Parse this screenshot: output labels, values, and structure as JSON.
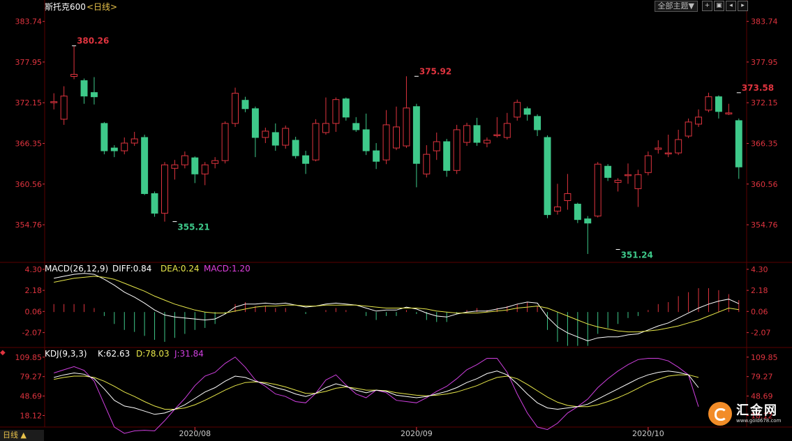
{
  "header": {
    "symbol": "斯托克600",
    "period": "<日线>",
    "theme_button": "全部主题▼",
    "tool_icons": [
      "crosshair-icon",
      "expand-icon",
      "prev-icon",
      "next-icon"
    ]
  },
  "bottom_bar": {
    "label": "日线 ▲"
  },
  "logo": {
    "name": "汇金网",
    "url": "www.gold678.com"
  },
  "colors": {
    "up": "#e0343f",
    "down": "#3ec98a",
    "diff_line": "#ffffff",
    "dea_line": "#e8e84a",
    "macd_label": "#e040e0",
    "k_line": "#ffffff",
    "d_line": "#e8e84a",
    "j_line": "#d040e0",
    "axis_text": "#e0343f",
    "grid": "#5a0000"
  },
  "chart_data": [
    {
      "type": "candlestick",
      "title": "斯托克600",
      "ylim": [
        349.5,
        385.0
      ],
      "y_ticks": [
        "383.74",
        "377.95",
        "372.15",
        "366.35",
        "360.56",
        "354.76"
      ],
      "x_ticks": [
        {
          "label": "2020/08",
          "index": 14
        },
        {
          "label": "2020/09",
          "index": 36
        },
        {
          "label": "2020/10",
          "index": 59
        }
      ],
      "annotations": [
        {
          "text": "380.26",
          "index": 2,
          "value": 380.26,
          "kind": "high"
        },
        {
          "text": "355.21",
          "index": 12,
          "value": 355.21,
          "kind": "low"
        },
        {
          "text": "375.92",
          "index": 36,
          "value": 375.92,
          "kind": "high"
        },
        {
          "text": "351.24",
          "index": 56,
          "value": 351.24,
          "kind": "low"
        },
        {
          "text": "373.58",
          "index": 68,
          "value": 373.58,
          "kind": "high"
        }
      ],
      "candles": [
        [
          372.3,
          372.3,
          371.2,
          373.5
        ],
        [
          369.8,
          373.1,
          369.0,
          374.5
        ],
        [
          375.9,
          376.2,
          375.5,
          380.26
        ],
        [
          375.3,
          373.1,
          372.0,
          375.6
        ],
        [
          373.6,
          373.0,
          371.9,
          375.8
        ],
        [
          369.2,
          365.3,
          364.8,
          369.4
        ],
        [
          365.7,
          365.3,
          364.4,
          366.1
        ],
        [
          365.3,
          366.4,
          364.8,
          367.2
        ],
        [
          366.4,
          367.0,
          366.0,
          368.0
        ],
        [
          367.2,
          359.2,
          359.0,
          367.6
        ],
        [
          359.2,
          356.4,
          355.9,
          359.5
        ],
        [
          356.4,
          363.3,
          355.21,
          363.7
        ],
        [
          362.8,
          363.3,
          361.2,
          364.0
        ],
        [
          363.3,
          364.6,
          362.8,
          365.2
        ],
        [
          364.3,
          362.0,
          360.7,
          364.5
        ],
        [
          362.0,
          363.3,
          360.4,
          363.7
        ],
        [
          363.5,
          363.9,
          362.8,
          364.4
        ],
        [
          363.9,
          369.2,
          363.5,
          369.5
        ],
        [
          369.2,
          373.5,
          368.7,
          374.3
        ],
        [
          372.5,
          371.3,
          370.8,
          373.0
        ],
        [
          371.3,
          367.2,
          364.4,
          371.6
        ],
        [
          367.2,
          368.1,
          366.4,
          368.6
        ],
        [
          367.9,
          366.1,
          365.3,
          369.2
        ],
        [
          366.1,
          368.5,
          365.6,
          368.9
        ],
        [
          366.8,
          364.6,
          364.2,
          367.3
        ],
        [
          364.6,
          363.5,
          362.0,
          365.3
        ],
        [
          364.0,
          369.2,
          363.8,
          369.8
        ],
        [
          367.9,
          369.2,
          367.6,
          372.9
        ],
        [
          369.2,
          372.6,
          368.0,
          372.9
        ],
        [
          372.7,
          370.1,
          369.6,
          372.9
        ],
        [
          369.2,
          368.3,
          368.0,
          370.1
        ],
        [
          368.3,
          365.3,
          364.7,
          370.6
        ],
        [
          365.3,
          363.8,
          362.7,
          366.4
        ],
        [
          364.0,
          369.0,
          363.4,
          371.1
        ],
        [
          365.7,
          368.7,
          365.4,
          371.6
        ],
        [
          366.0,
          371.4,
          365.7,
          375.92
        ],
        [
          371.6,
          363.5,
          360.1,
          372.0
        ],
        [
          362.0,
          364.8,
          361.5,
          366.1
        ],
        [
          365.3,
          366.6,
          364.0,
          367.9
        ],
        [
          366.6,
          362.5,
          361.6,
          367.0
        ],
        [
          362.5,
          368.3,
          362.0,
          369.0
        ],
        [
          366.5,
          368.9,
          366.0,
          369.3
        ],
        [
          368.9,
          366.5,
          366.0,
          370.0
        ],
        [
          366.4,
          366.8,
          365.8,
          367.2
        ],
        [
          367.6,
          367.6,
          367.2,
          370.1
        ],
        [
          367.2,
          369.2,
          366.9,
          370.7
        ],
        [
          370.1,
          372.2,
          369.6,
          372.6
        ],
        [
          371.3,
          370.5,
          369.6,
          371.6
        ],
        [
          370.2,
          368.3,
          367.4,
          370.5
        ],
        [
          367.2,
          356.2,
          355.7,
          367.5
        ],
        [
          356.7,
          357.3,
          356.2,
          360.6
        ],
        [
          358.2,
          359.2,
          356.9,
          362.0
        ],
        [
          357.7,
          355.5,
          355.0,
          357.9
        ],
        [
          355.6,
          355.0,
          350.6,
          356.0
        ],
        [
          356.0,
          363.4,
          355.8,
          363.7
        ],
        [
          363.1,
          361.5,
          361.0,
          363.4
        ],
        [
          360.8,
          361.1,
          359.5,
          361.4
        ],
        [
          361.8,
          361.9,
          360.6,
          363.5
        ],
        [
          359.9,
          361.9,
          357.3,
          362.6
        ],
        [
          362.2,
          364.6,
          361.8,
          365.2
        ],
        [
          365.5,
          365.7,
          364.9,
          366.8
        ],
        [
          365.0,
          365.0,
          364.4,
          367.6
        ],
        [
          365.0,
          366.9,
          364.7,
          368.3
        ],
        [
          367.4,
          369.4,
          367.1,
          369.9
        ],
        [
          369.1,
          370.1,
          368.7,
          371.2
        ],
        [
          371.1,
          373.0,
          370.8,
          373.58
        ],
        [
          373.0,
          370.9,
          369.9,
          373.2
        ],
        [
          370.7,
          370.7,
          370.4,
          372.0
        ],
        [
          369.6,
          363.0,
          361.3,
          369.9
        ]
      ]
    },
    {
      "type": "line",
      "title": "MACD(26,12,9)",
      "labels": [
        {
          "text": "MACD(26,12,9)",
          "color": "#ffffff"
        },
        {
          "text": "DIFF:0.84",
          "color": "#ffffff"
        },
        {
          "text": "DEA:0.24",
          "color": "#e8e84a"
        },
        {
          "text": "MACD:1.20",
          "color": "#e040e0"
        }
      ],
      "ylim": [
        -3.5,
        5.0
      ],
      "y_ticks": [
        "4.30",
        "2.18",
        "0.06",
        "-2.07"
      ],
      "series": [
        {
          "name": "DIFF",
          "values": [
            3.4,
            3.6,
            3.8,
            3.9,
            3.8,
            3.3,
            2.7,
            2.0,
            1.5,
            0.9,
            0.2,
            -0.3,
            -0.5,
            -0.6,
            -0.7,
            -0.8,
            -0.7,
            -0.2,
            0.5,
            0.8,
            0.8,
            0.9,
            0.8,
            0.9,
            0.7,
            0.5,
            0.6,
            0.8,
            0.9,
            0.8,
            0.7,
            0.4,
            0.1,
            0.2,
            0.2,
            0.5,
            0.3,
            -0.1,
            -0.4,
            -0.5,
            -0.2,
            0.0,
            0.1,
            0.1,
            0.3,
            0.5,
            0.8,
            1.0,
            0.9,
            -0.5,
            -1.5,
            -2.1,
            -2.5,
            -2.9,
            -2.6,
            -2.5,
            -2.5,
            -2.3,
            -2.2,
            -1.8,
            -1.4,
            -1.1,
            -0.6,
            -0.1,
            0.4,
            0.8,
            1.1,
            1.3,
            0.84
          ]
        },
        {
          "name": "DEA",
          "values": [
            3.0,
            3.2,
            3.4,
            3.5,
            3.6,
            3.5,
            3.3,
            2.9,
            2.5,
            2.1,
            1.6,
            1.2,
            0.8,
            0.5,
            0.2,
            0.0,
            -0.1,
            -0.1,
            0.1,
            0.3,
            0.5,
            0.6,
            0.6,
            0.7,
            0.7,
            0.6,
            0.6,
            0.7,
            0.7,
            0.7,
            0.7,
            0.6,
            0.5,
            0.4,
            0.4,
            0.4,
            0.4,
            0.3,
            0.1,
            0.0,
            -0.1,
            -0.1,
            -0.1,
            0.0,
            0.1,
            0.2,
            0.4,
            0.5,
            0.6,
            0.4,
            0.0,
            -0.4,
            -0.8,
            -1.2,
            -1.5,
            -1.7,
            -1.9,
            -2.0,
            -2.0,
            -1.9,
            -1.8,
            -1.6,
            -1.4,
            -1.1,
            -0.8,
            -0.4,
            0.0,
            0.4,
            0.24
          ]
        },
        {
          "name": "MACD",
          "values": [
            0.8,
            0.8,
            0.8,
            0.8,
            0.4,
            -0.4,
            -1.2,
            -1.8,
            -2.0,
            -2.4,
            -2.8,
            -3.0,
            -2.6,
            -2.2,
            -1.8,
            -1.6,
            -1.2,
            -0.2,
            0.8,
            1.0,
            0.6,
            0.6,
            0.4,
            0.4,
            0.0,
            -0.2,
            0.0,
            0.2,
            0.4,
            0.2,
            0.0,
            -0.4,
            -0.8,
            -0.4,
            -0.4,
            0.2,
            -0.2,
            -0.8,
            -1.0,
            -1.0,
            -0.2,
            0.2,
            0.4,
            0.2,
            0.4,
            0.6,
            0.8,
            1.0,
            0.6,
            -1.8,
            -3.0,
            -3.4,
            -3.4,
            -3.4,
            -2.2,
            -1.6,
            -1.2,
            -0.6,
            -0.4,
            0.2,
            0.8,
            1.0,
            1.6,
            2.0,
            2.4,
            2.4,
            2.2,
            1.8,
            1.2
          ]
        }
      ]
    },
    {
      "type": "line",
      "title": "KDJ(9,3,3)",
      "labels": [
        {
          "text": "KDJ(9,3,3)",
          "color": "#ffffff"
        },
        {
          "text": "K:62.63",
          "color": "#ffffff"
        },
        {
          "text": "D:78.03",
          "color": "#e8e84a"
        },
        {
          "text": "J:31.84",
          "color": "#d040e0"
        }
      ],
      "ylim": [
        0,
        125
      ],
      "y_ticks": [
        "109.85",
        "79.27",
        "48.69",
        "18.12"
      ],
      "series": [
        {
          "name": "K",
          "values": [
            78,
            82,
            85,
            83,
            76,
            60,
            42,
            33,
            30,
            25,
            20,
            22,
            28,
            35,
            45,
            55,
            62,
            72,
            80,
            78,
            72,
            68,
            62,
            58,
            52,
            48,
            53,
            62,
            68,
            64,
            58,
            54,
            58,
            56,
            50,
            48,
            46,
            48,
            52,
            56,
            62,
            70,
            76,
            84,
            88,
            82,
            68,
            52,
            38,
            30,
            28,
            30,
            32,
            36,
            44,
            52,
            60,
            68,
            76,
            82,
            86,
            88,
            86,
            82,
            62
          ]
        },
        {
          "name": "D",
          "values": [
            75,
            78,
            80,
            80,
            78,
            72,
            64,
            55,
            48,
            40,
            33,
            28,
            28,
            30,
            35,
            42,
            50,
            58,
            65,
            70,
            71,
            70,
            67,
            63,
            58,
            53,
            53,
            56,
            61,
            63,
            61,
            58,
            58,
            57,
            54,
            52,
            50,
            49,
            50,
            52,
            55,
            60,
            65,
            72,
            78,
            80,
            76,
            67,
            57,
            47,
            39,
            34,
            32,
            32,
            35,
            40,
            46,
            53,
            61,
            69,
            75,
            80,
            82,
            82,
            78
          ]
        },
        {
          "name": "J",
          "values": [
            85,
            90,
            95,
            89,
            72,
            36,
            0,
            -10,
            -6,
            -5,
            -6,
            10,
            28,
            45,
            65,
            80,
            86,
            100,
            110,
            94,
            74,
            64,
            52,
            48,
            40,
            38,
            53,
            74,
            82,
            66,
            52,
            46,
            58,
            54,
            42,
            40,
            38,
            46,
            56,
            64,
            76,
            90,
            98,
            108,
            108,
            86,
            52,
            22,
            0,
            -4,
            6,
            22,
            32,
            44,
            62,
            76,
            88,
            98,
            106,
            108,
            108,
            104,
            94,
            82,
            32
          ]
        }
      ]
    }
  ]
}
